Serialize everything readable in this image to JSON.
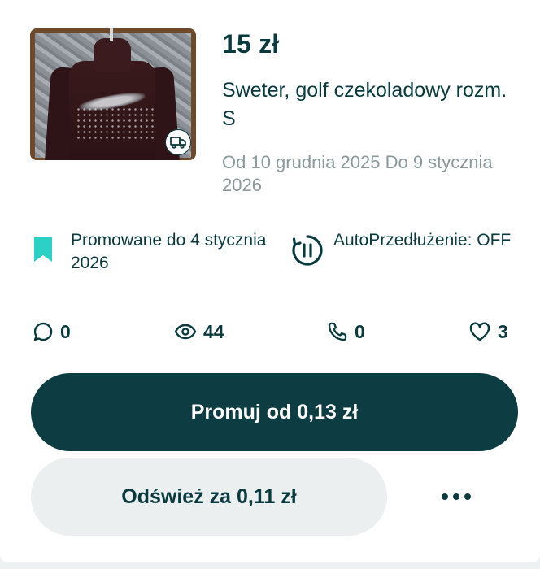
{
  "listing": {
    "price": "15 zł",
    "title": "Sweter, golf czekoladowy rozm. S",
    "dates": "Od 10 grudnia 2025 Do 9 stycznia 2026",
    "thumbnail_icon": "delivery-truck-icon"
  },
  "info": {
    "promoted": "Promowane do 4 stycznia 2026",
    "auto_renew": "AutoPrzedłużenie: OFF",
    "accent": "#2bd1c4"
  },
  "stats": {
    "messages": "0",
    "views": "44",
    "calls": "0",
    "likes": "3"
  },
  "actions": {
    "promote_label": "Promuj od 0,13 zł",
    "refresh_label": "Odśwież za 0,11 zł",
    "more_icon": "more-horizontal-icon"
  },
  "colors": {
    "primary": "#0d3d42",
    "text": "#0a3a3e",
    "muted": "#8a999b",
    "secondary_bg": "#eceff0"
  }
}
